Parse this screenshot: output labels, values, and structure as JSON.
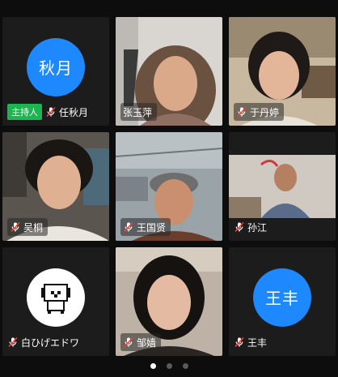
{
  "tiles": [
    {
      "id": "qiuyue",
      "name": "任秋月",
      "avatar_text": "秋月",
      "badge": "主持人",
      "avatar_color": "#1e88ff"
    },
    {
      "id": "zhangyuping",
      "name": "张玉萍"
    },
    {
      "id": "yudanting",
      "name": "于丹婷"
    },
    {
      "id": "wutong",
      "name": "吴桐"
    },
    {
      "id": "wangguoxian",
      "name": "王国贤"
    },
    {
      "id": "sunjiang",
      "name": "孙江"
    },
    {
      "id": "shirohige",
      "name": "白ひげエドワ"
    },
    {
      "id": "zouyuan",
      "name": "邹嫱"
    },
    {
      "id": "wangfeng",
      "name": "王丰",
      "avatar_text": "王丰",
      "avatar_color": "#1e88ff"
    }
  ],
  "pager": {
    "total": 3,
    "current": 1
  },
  "icons": {
    "mic": "muted-mic-icon"
  },
  "colors": {
    "host_badge": "#1fb452",
    "avatar": "#1e88ff",
    "mic_muted": "#ff3b30"
  }
}
